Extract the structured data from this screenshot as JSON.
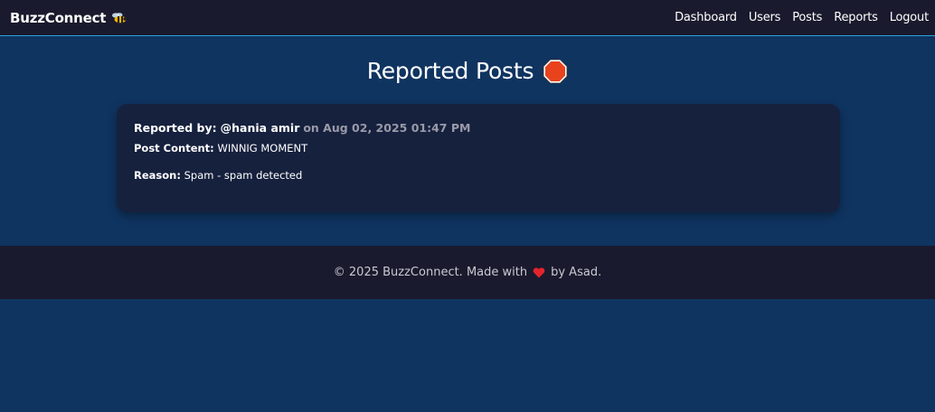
{
  "navbar": {
    "brand": "BuzzConnect",
    "brand_icon": "bee-icon",
    "links": [
      "Dashboard",
      "Users",
      "Posts",
      "Reports",
      "Logout"
    ],
    "border_color": "#2aa3d8"
  },
  "page": {
    "title": "Reported Posts",
    "title_icon": "stop-sign-icon"
  },
  "report": {
    "reported_by_label": "Reported by:",
    "reporter": "@hania amir",
    "date_text": "on Aug 02, 2025 01:47 PM",
    "post_content_label": "Post Content:",
    "post_content": "WINNIG MOMENT",
    "reason_label": "Reason:",
    "reason": "Spam - spam detected"
  },
  "footer": {
    "text_before": "© 2025 BuzzConnect. Made with",
    "heart_icon": "heart-icon",
    "text_after": "by Asad."
  },
  "colors": {
    "background": "#0f3460",
    "navbar": "#1a1a2e",
    "card": "#16213e",
    "footer": "#1a1a2e",
    "heart": "#e3242b",
    "stop": "#e8431d"
  }
}
